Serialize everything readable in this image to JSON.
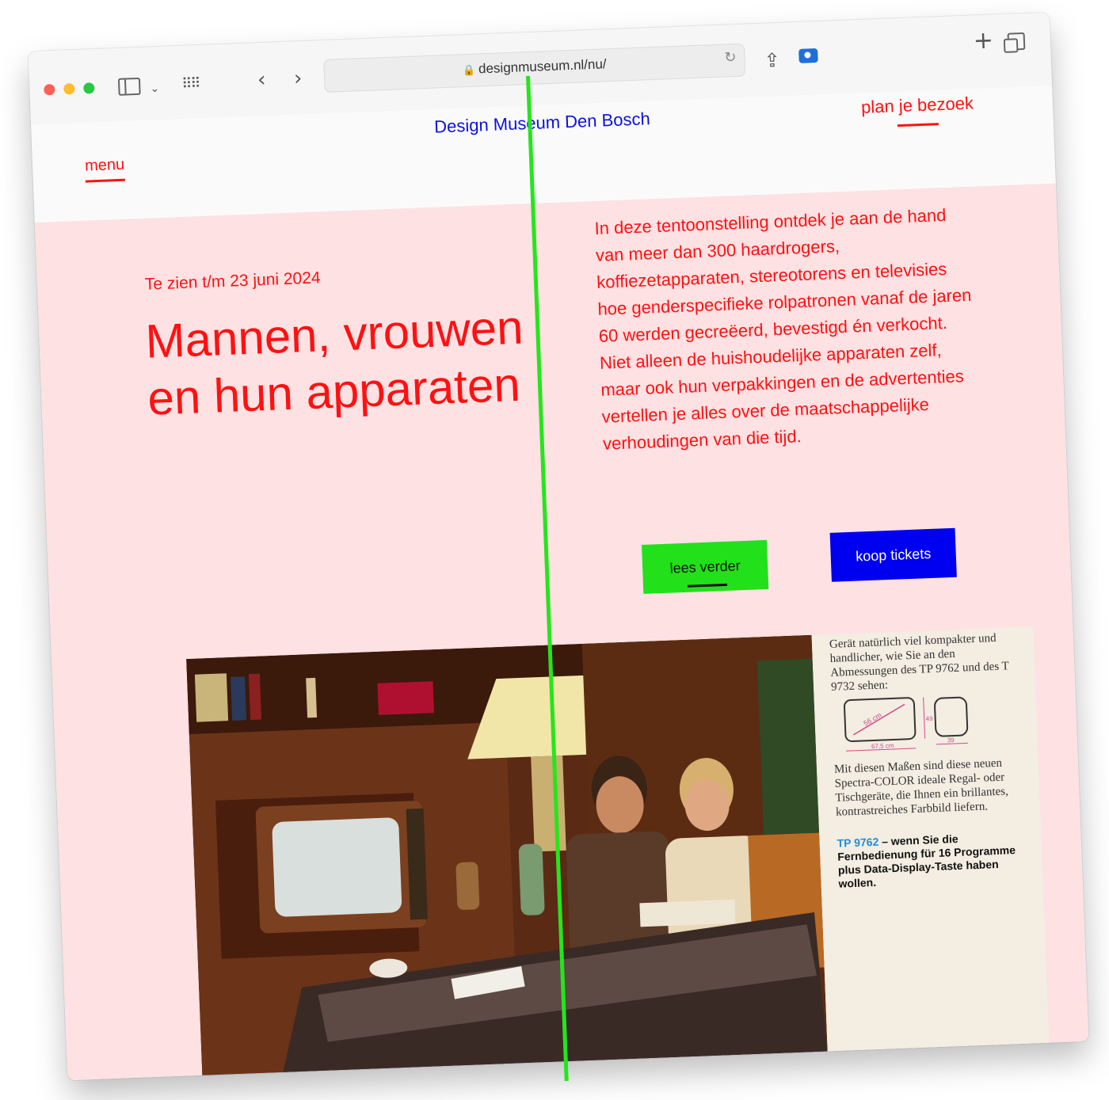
{
  "browser": {
    "url": "designmuseum.nl/nu/"
  },
  "header": {
    "menu_label": "menu",
    "site_title": "Design Museum Den Bosch",
    "plan_label": "plan je bezoek"
  },
  "hero": {
    "dates": "Te zien t/m 23 juni 2024",
    "title": "Mannen, vrouwen en hun apparaten",
    "intro": "In deze tentoonstelling ontdek je aan de hand van meer dan 300 haardrogers, koffiezetapparaten, stereotorens en televisies hoe genderspecifieke rolpatronen vanaf de jaren 60 werden gecreëerd, bevestigd én verkocht. Niet alleen de huishoudelijke apparaten zelf, maar ook hun verpakkingen en de advertenties vertellen je alles over de maatschappelijke verhoudingen van die tijd.",
    "read_more_label": "lees verder",
    "tickets_label": "koop tickets"
  },
  "ad": {
    "p1": "Gerät natürlich viel kompakter und handlicher, wie Sie an den Abmessungen des TP 9762 und des T 9732 sehen:",
    "dim_diag": "56 cm",
    "dim_width": "67,5 cm",
    "dim_height": "49",
    "dim_depth": "39",
    "p2": "Mit diesen Maßen sind diese neuen Spectra-COLOR ideale Regal- oder Tischgeräte, die Ihnen ein brillantes, kontrastreiches Farbbild liefern.",
    "p3_model": "TP 9762",
    "p3_rest": " – wenn Sie die Fernbedienung für 16 Programme plus Data-Display-Taste haben wollen."
  },
  "colors": {
    "accent_red": "#ff1111",
    "title_blue": "#0b10e0",
    "pink_bg": "#fde1e3",
    "button_green": "#22e01a",
    "button_blue": "#0000f0",
    "divider_green": "#25e51c"
  }
}
